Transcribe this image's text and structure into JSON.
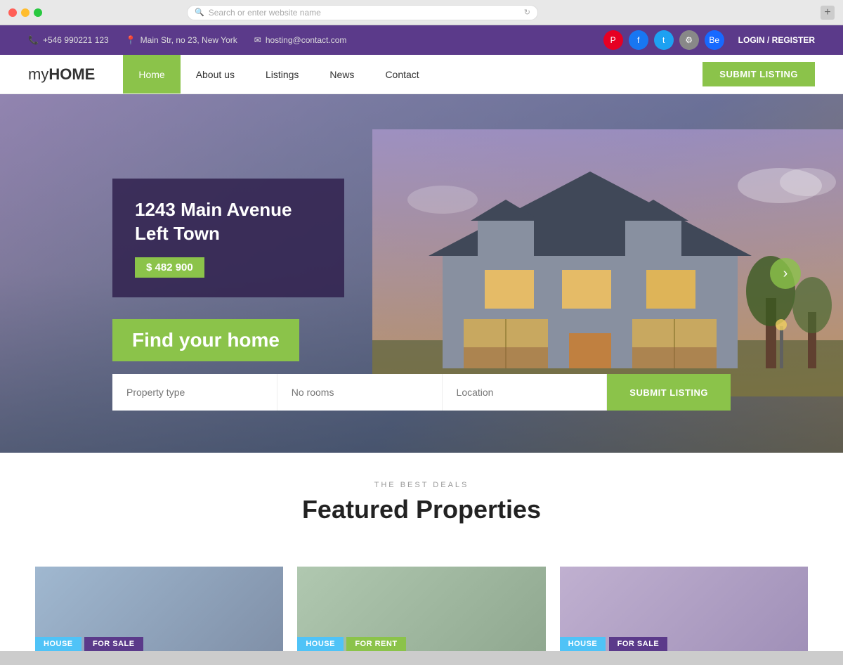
{
  "browser": {
    "address_placeholder": "Search or enter website name"
  },
  "topbar": {
    "phone": "+546 990221 123",
    "address": "Main Str, no 23, New York",
    "email": "hosting@contact.com",
    "login_register": "LOGIN / REGISTER",
    "social": [
      "P",
      "f",
      "t",
      "⚙",
      "Be"
    ]
  },
  "nav": {
    "logo_prefix": "my",
    "logo_suffix": "HOME",
    "links": [
      "Home",
      "About us",
      "Listings",
      "News",
      "Contact"
    ],
    "active_link": "Home",
    "submit_label": "SUBMIT LISTING"
  },
  "hero": {
    "property_title": "1243 Main Avenue Left Town",
    "property_price": "$ 482 900",
    "find_home_text": "Find your home",
    "search_fields": {
      "property_type": "Property type",
      "no_rooms": "No rooms",
      "location": "Location",
      "submit": "SUBMIT LISTING"
    }
  },
  "featured": {
    "subtitle": "THE BEST DEALS",
    "title": "Featured Properties",
    "cards": [
      {
        "type": "HOUSE",
        "status": "FOR SALE",
        "bg": "#a0b8d0"
      },
      {
        "type": "HOUSE",
        "status": "FOR RENT",
        "bg": "#b0c8b0"
      },
      {
        "type": "HOUSE",
        "status": "FOR SALE",
        "bg": "#c0b0d0"
      }
    ]
  }
}
